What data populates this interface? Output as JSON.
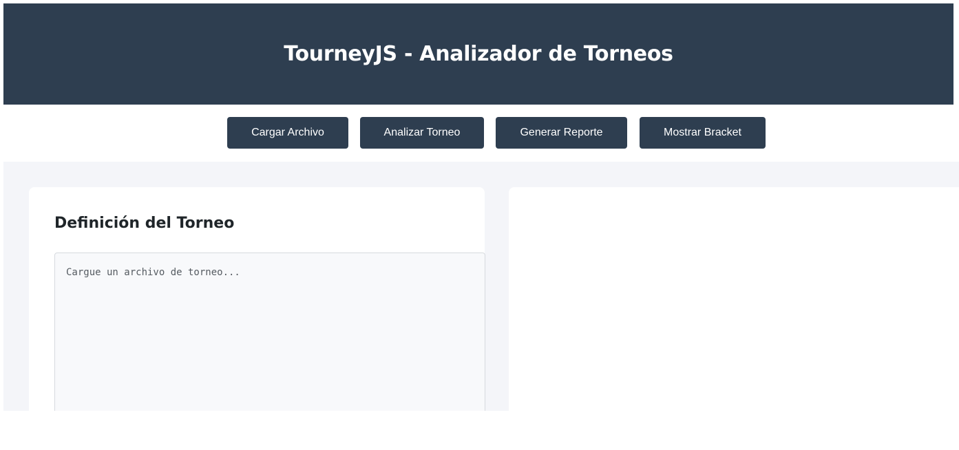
{
  "header": {
    "title": "TourneyJS - Analizador de Torneos"
  },
  "toolbar": {
    "buttons": [
      {
        "label": "Cargar Archivo"
      },
      {
        "label": "Analizar Torneo"
      },
      {
        "label": "Generar Reporte"
      },
      {
        "label": "Mostrar Bracket"
      }
    ]
  },
  "definition_panel": {
    "title": "Definición del Torneo",
    "editor": {
      "value": "",
      "placeholder": "Cargue un archivo de torneo..."
    }
  },
  "colors": {
    "header_bg": "#2e3e50",
    "button_bg": "#2e3e50",
    "main_bg": "#f4f5f9",
    "card_bg": "#ffffff",
    "editor_bg": "#f8f9fb"
  }
}
